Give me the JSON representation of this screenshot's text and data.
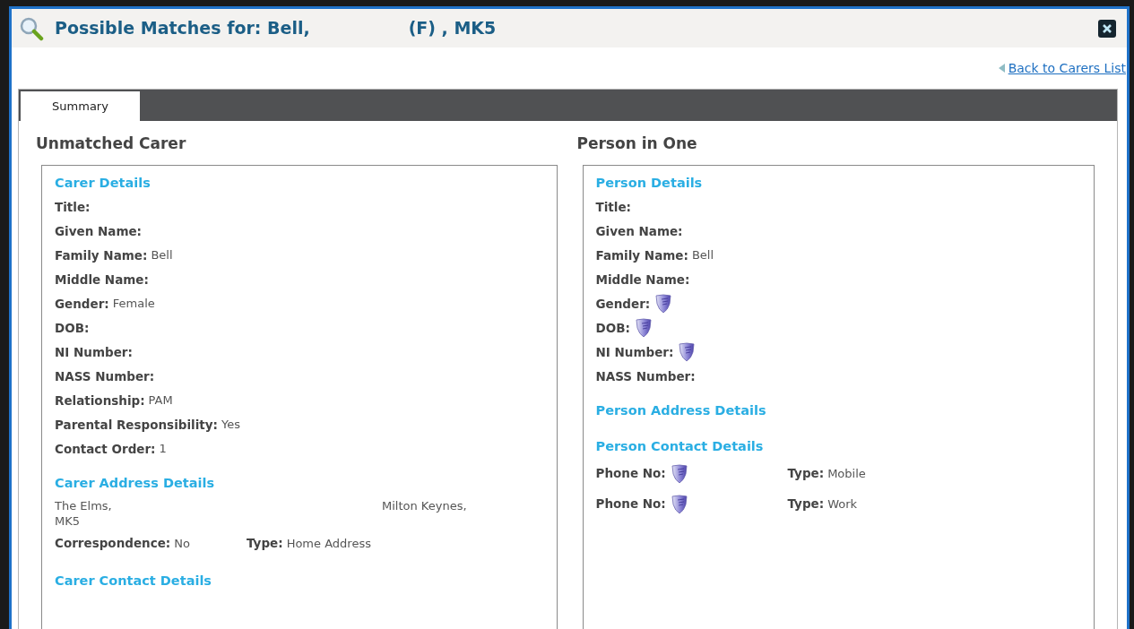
{
  "window": {
    "title_parts": [
      "Possible Matches for: Bell,",
      "(F) , MK5"
    ]
  },
  "back_link": "Back to Carers List",
  "tabs": [
    {
      "label": "Summary",
      "selected": true
    }
  ],
  "panels": [
    {
      "heading": "Unmatched Carer",
      "sections": [
        {
          "title": "Carer Details",
          "rows": [
            {
              "kind": "field",
              "label": "Title:",
              "restricted": false
            },
            {
              "kind": "field",
              "label": "Given Name:",
              "restricted": false
            },
            {
              "kind": "field",
              "label": "Family Name:",
              "value": "Bell",
              "restricted": false
            },
            {
              "kind": "field",
              "label": "Middle Name:",
              "restricted": false
            },
            {
              "kind": "field",
              "label": "Gender:",
              "value": "Female",
              "restricted": false
            },
            {
              "kind": "field",
              "label": "DOB:",
              "restricted": false
            },
            {
              "kind": "field",
              "label": "NI Number:",
              "restricted": false
            },
            {
              "kind": "field",
              "label": "NASS Number:",
              "restricted": false
            },
            {
              "kind": "field",
              "label": "Relationship:",
              "value": "PAM",
              "restricted": false
            },
            {
              "kind": "field",
              "label": "Parental Responsibility:",
              "value": "Yes",
              "restricted": false
            },
            {
              "kind": "field",
              "label": "Contact Order:",
              "value": "1",
              "restricted": false
            }
          ]
        },
        {
          "title": "Carer Address Details",
          "rows": [
            {
              "kind": "address",
              "lines": [
                [
                  "The Elms,",
                  "Milton Keynes,"
                ],
                [
                  "MK5"
                ]
              ]
            },
            {
              "kind": "pair",
              "items": [
                {
                  "label": "Correspondence:",
                  "value": "No",
                  "restricted": false
                },
                {
                  "label": "Type:",
                  "value": "Home Address",
                  "restricted": false
                }
              ]
            }
          ]
        },
        {
          "title": "Carer Contact Details"
        }
      ]
    },
    {
      "heading": "Person in One",
      "sections": [
        {
          "title": "Person Details",
          "rows": [
            {
              "kind": "field",
              "label": "Title:",
              "restricted": false
            },
            {
              "kind": "field",
              "label": "Given Name:",
              "restricted": false
            },
            {
              "kind": "field",
              "label": "Family Name:",
              "value": "Bell",
              "restricted": false
            },
            {
              "kind": "field",
              "label": "Middle Name:",
              "restricted": false
            },
            {
              "kind": "field",
              "label": "Gender:",
              "restricted": true
            },
            {
              "kind": "field",
              "label": "DOB:",
              "restricted": true
            },
            {
              "kind": "field",
              "label": "NI Number:",
              "restricted": true
            },
            {
              "kind": "field",
              "label": "NASS Number:",
              "restricted": false
            }
          ]
        },
        {
          "title": "Person Address Details"
        },
        {
          "title": "Person Contact Details",
          "rows": [
            {
              "kind": "pair",
              "items": [
                {
                  "label": "Phone No:",
                  "restricted": true
                },
                {
                  "label": "Type:",
                  "value": "Mobile",
                  "restricted": false
                }
              ]
            },
            {
              "kind": "pair",
              "items": [
                {
                  "label": "Phone No:",
                  "restricted": true
                },
                {
                  "label": "Type:",
                  "value": "Work",
                  "restricted": false
                }
              ]
            }
          ]
        }
      ]
    }
  ]
}
